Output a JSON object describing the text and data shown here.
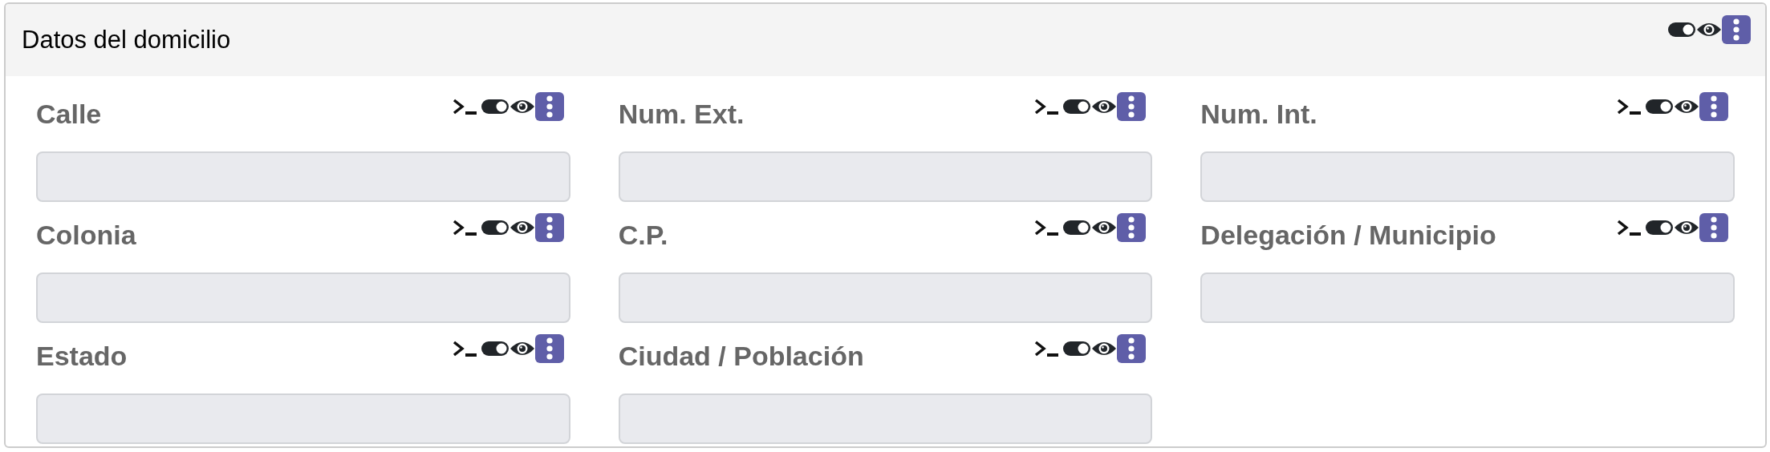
{
  "panel": {
    "title": "Datos del domicilio"
  },
  "fields": [
    {
      "label": "Calle"
    },
    {
      "label": "Num. Ext."
    },
    {
      "label": "Num. Int."
    },
    {
      "label": "Colonia"
    },
    {
      "label": "C.P."
    },
    {
      "label": "Delegación / Municipio"
    },
    {
      "label": "Estado"
    },
    {
      "label": "Ciudad / Población"
    }
  ]
}
